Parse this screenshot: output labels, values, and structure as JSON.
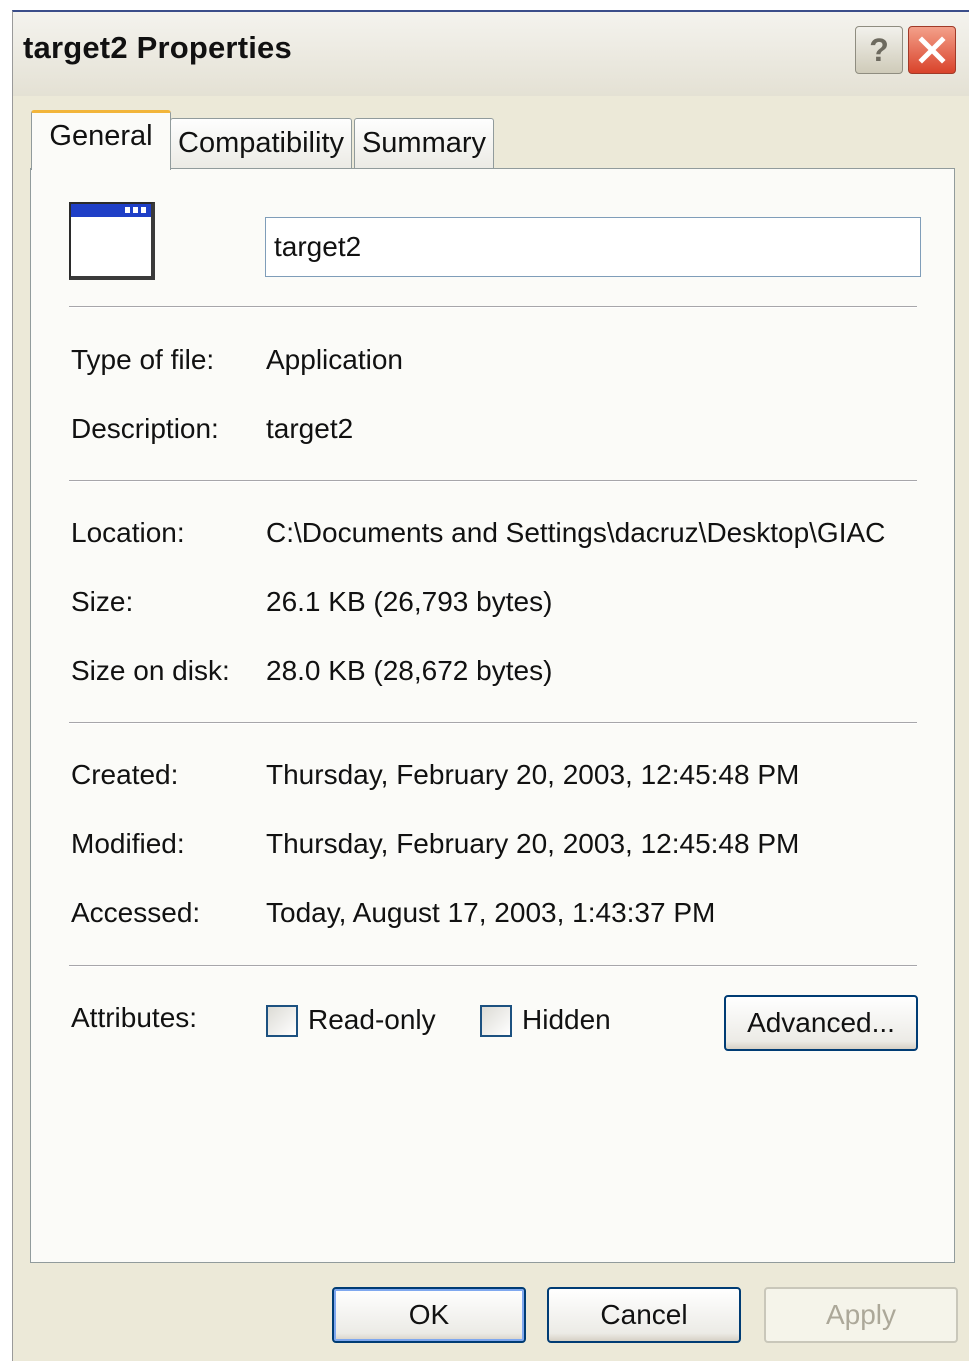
{
  "window": {
    "title": "target2 Properties",
    "help_symbol": "?",
    "close_symbol": "✕"
  },
  "tabs": [
    {
      "label": "General",
      "selected": true
    },
    {
      "label": "Compatibility",
      "selected": false
    },
    {
      "label": "Summary",
      "selected": false
    }
  ],
  "general": {
    "file_name": "target2",
    "type_label": "Type of file:",
    "type_value": "Application",
    "description_label": "Description:",
    "description_value": "target2",
    "location_label": "Location:",
    "location_value": "C:\\Documents and Settings\\dacruz\\Desktop\\GIAC",
    "size_label": "Size:",
    "size_value": "26.1 KB (26,793 bytes)",
    "size_on_disk_label": "Size on disk:",
    "size_on_disk_value": "28.0 KB (28,672 bytes)",
    "created_label": "Created:",
    "created_value": "Thursday, February 20, 2003, 12:45:48 PM",
    "modified_label": "Modified:",
    "modified_value": "Thursday, February 20, 2003, 12:45:48 PM",
    "accessed_label": "Accessed:",
    "accessed_value": "Today, August 17, 2003, 1:43:37 PM",
    "attributes_label": "Attributes:",
    "readonly_label": "Read-only",
    "readonly_checked": false,
    "hidden_label": "Hidden",
    "hidden_checked": false,
    "advanced_button": "Advanced..."
  },
  "buttons": {
    "ok": "OK",
    "cancel": "Cancel",
    "apply": "Apply"
  },
  "colors": {
    "dialog_bg": "#ece9d8",
    "selected_tab_accent": "#f2b53a",
    "button_border": "#003c74",
    "close_button": "#d9432b"
  },
  "icons": {
    "file_icon": "application-window-icon",
    "help": "help-icon",
    "close": "close-icon"
  }
}
